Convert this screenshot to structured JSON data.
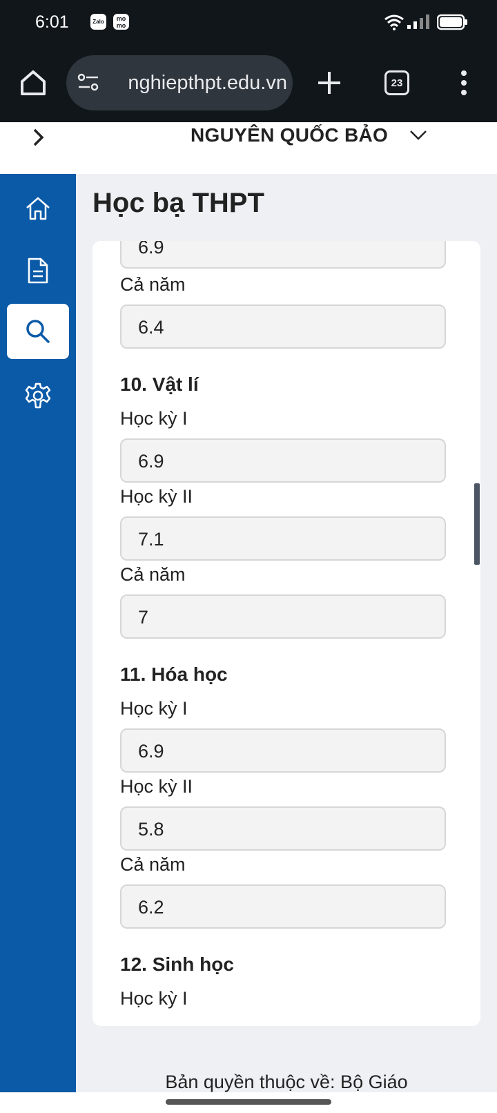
{
  "status_bar": {
    "time": "6:01",
    "apps": [
      {
        "name": "Zalo",
        "icon": "zalo-icon"
      },
      {
        "name": "mo mo",
        "icon": "momo-icon"
      }
    ],
    "icons": [
      "wifi-icon",
      "signal-icon",
      "battery-icon"
    ]
  },
  "browser": {
    "url": "nghiepthpt.edu.vn",
    "tab_count": "23",
    "icons": [
      "home-icon",
      "site-settings-icon",
      "new-tab-icon",
      "more-vert-icon"
    ]
  },
  "header": {
    "user_name": "NGUYÊN QUỐC BẢO"
  },
  "sidebar": {
    "items": [
      {
        "name": "home",
        "icon": "home-icon",
        "active": false
      },
      {
        "name": "document",
        "icon": "document-icon",
        "active": false
      },
      {
        "name": "search",
        "icon": "search-icon",
        "active": true
      },
      {
        "name": "settings",
        "icon": "gear-icon",
        "active": false
      }
    ]
  },
  "page": {
    "title": "Học bạ THPT"
  },
  "partial_subject": {
    "prev_value": "6.9",
    "year_label": "Cả năm",
    "year_value": "6.4"
  },
  "subjects": [
    {
      "heading": "10. Vật lí",
      "sem1_label": "Học kỳ I",
      "sem1_value": "6.9",
      "sem2_label": "Học kỳ II",
      "sem2_value": "7.1",
      "year_label": "Cả năm",
      "year_value": "7"
    },
    {
      "heading": "11. Hóa học",
      "sem1_label": "Học kỳ I",
      "sem1_value": "6.9",
      "sem2_label": "Học kỳ II",
      "sem2_value": "5.8",
      "year_label": "Cả năm",
      "year_value": "6.2"
    },
    {
      "heading": "12. Sinh học",
      "sem1_label": "Học kỳ I"
    }
  ],
  "footer": {
    "text": "Bản quyền thuộc về: Bộ Giáo"
  },
  "colors": {
    "sidebar": "#0b5aa8",
    "chrome": "#11161b",
    "background": "#eef0f4"
  }
}
